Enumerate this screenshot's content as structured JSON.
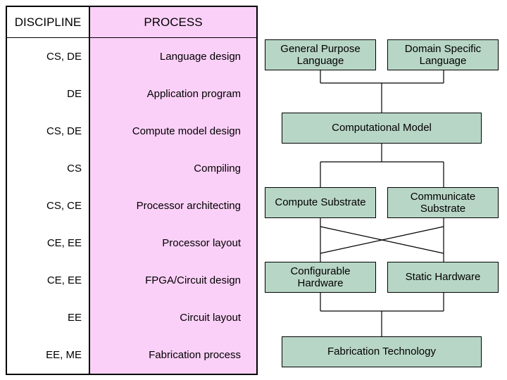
{
  "headers": {
    "discipline": "DISCIPLINE",
    "process": "PROCESS"
  },
  "rows": [
    {
      "discipline": "CS, DE",
      "process": "Language design"
    },
    {
      "discipline": "DE",
      "process": "Application program"
    },
    {
      "discipline": "CS, DE",
      "process": "Compute model design"
    },
    {
      "discipline": "CS",
      "process": "Compiling"
    },
    {
      "discipline": "CS, CE",
      "process": "Processor architecting"
    },
    {
      "discipline": "CE, EE",
      "process": "Processor layout"
    },
    {
      "discipline": "CE, EE",
      "process": "FPGA/Circuit design"
    },
    {
      "discipline": "EE",
      "process": "Circuit layout"
    },
    {
      "discipline": "EE, ME",
      "process": "Fabrication process"
    }
  ],
  "boxes": {
    "gpl": "General Purpose Language",
    "dsl": "Domain Specific Language",
    "compmodel": "Computational Model",
    "compsub": "Compute Substrate",
    "commsub": "Communicate Substrate",
    "confhw": "Configurable Hardware",
    "stathw": "Static Hardware",
    "fabtech": "Fabrication Technology"
  }
}
